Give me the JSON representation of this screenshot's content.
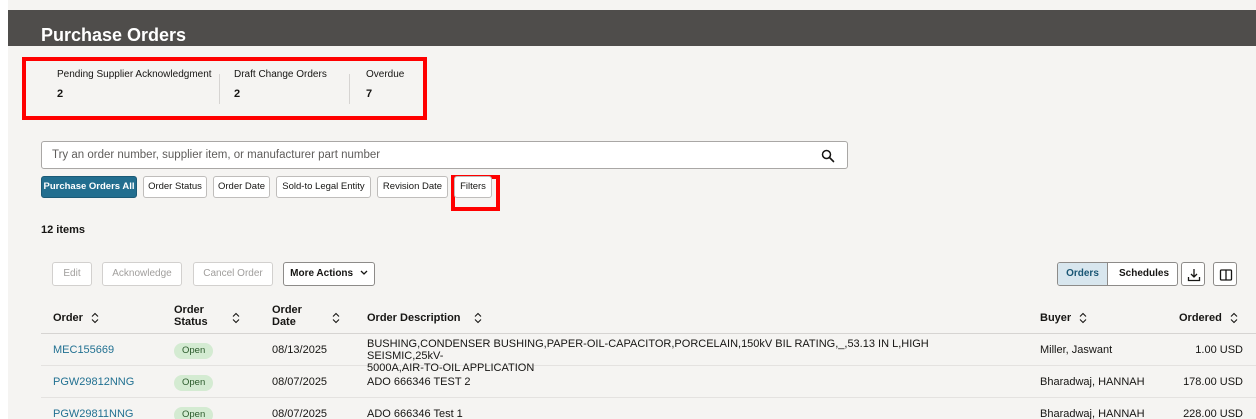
{
  "page": {
    "title": "Purchase Orders"
  },
  "metrics": [
    {
      "label": "Pending Supplier Acknowledgment",
      "value": "2"
    },
    {
      "label": "Draft Change Orders",
      "value": "2"
    },
    {
      "label": "Overdue",
      "value": "7"
    }
  ],
  "search": {
    "placeholder": "Try an order number, supplier item, or manufacturer part number",
    "value": ""
  },
  "filters": [
    {
      "label": "Purchase Orders All",
      "active": true
    },
    {
      "label": "Order Status"
    },
    {
      "label": "Order Date"
    },
    {
      "label": "Sold-to Legal Entity"
    },
    {
      "label": "Revision Date"
    },
    {
      "label": "Filters"
    }
  ],
  "results": {
    "count_label": "12 items"
  },
  "toolbar": {
    "edit": "Edit",
    "acknowledge": "Acknowledge",
    "cancel_order": "Cancel Order",
    "more_actions": "More Actions",
    "view_orders": "Orders",
    "view_schedules": "Schedules"
  },
  "columns": {
    "order": "Order",
    "order_status_1": "Order",
    "order_status_2": "Status",
    "order_date_1": "Order",
    "order_date_2": "Date",
    "description": "Order Description",
    "buyer": "Buyer",
    "ordered": "Ordered"
  },
  "rows": [
    {
      "order": "MEC155669",
      "status": "Open",
      "date": "08/13/2025",
      "description_line1": "BUSHING,CONDENSER BUSHING,PAPER-OIL-CAPACITOR,PORCELAIN,150kV BIL RATING,_,53.13 IN L,HIGH SEISMIC,25kV-",
      "description_line2": "5000A,AIR-TO-OIL APPLICATION",
      "buyer": "Miller, Jaswant",
      "ordered": "1.00 USD"
    },
    {
      "order": "PGW29812NNG",
      "status": "Open",
      "date": "08/07/2025",
      "description_line1": "ADO 666346 TEST 2",
      "description_line2": "",
      "buyer": "Bharadwaj, HANNAH",
      "ordered": "178.00 USD"
    },
    {
      "order": "PGW29811NNG",
      "status": "Open",
      "date": "08/07/2025",
      "description_line1": "ADO 666346 Test 1",
      "description_line2": "",
      "buyer": "Bharadwaj, HANNAH",
      "ordered": "228.00 USD"
    }
  ],
  "colors": {
    "header_bg": "#4f4d4b",
    "accent": "#226e8f",
    "link": "#227192",
    "highlight": "#ff0000",
    "badge_bg": "#d4ebd2"
  }
}
